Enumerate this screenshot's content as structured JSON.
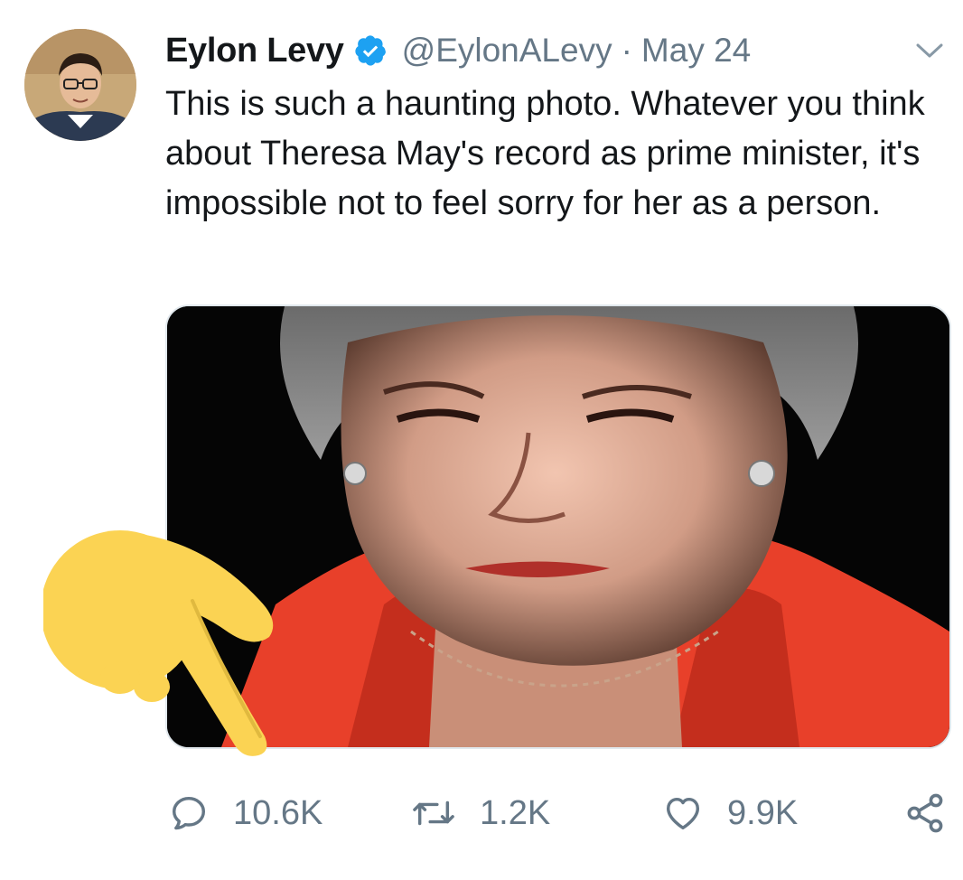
{
  "tweet": {
    "author_name": "Eylon Levy",
    "handle": "@EylonALevy",
    "separator": "·",
    "date": "May 24",
    "text": "This is such a haunting photo. Whatever you think about Theresa May's record as prime minister, it's impossible not to feel sorry for her as a person."
  },
  "actions": {
    "reply_count": "10.6K",
    "retweet_count": "1.2K",
    "like_count": "9.9K"
  },
  "icons": {
    "verified": "verified-badge-icon",
    "caret": "chevron-down-icon",
    "reply": "reply-icon",
    "retweet": "retweet-icon",
    "like": "heart-icon",
    "share": "share-icon",
    "overlay": "pointing-hand-emoji"
  },
  "colors": {
    "verified_blue": "#1da1f2",
    "secondary_text": "#657786",
    "primary_text": "#14171a",
    "emoji_yellow": "#fbd353"
  }
}
